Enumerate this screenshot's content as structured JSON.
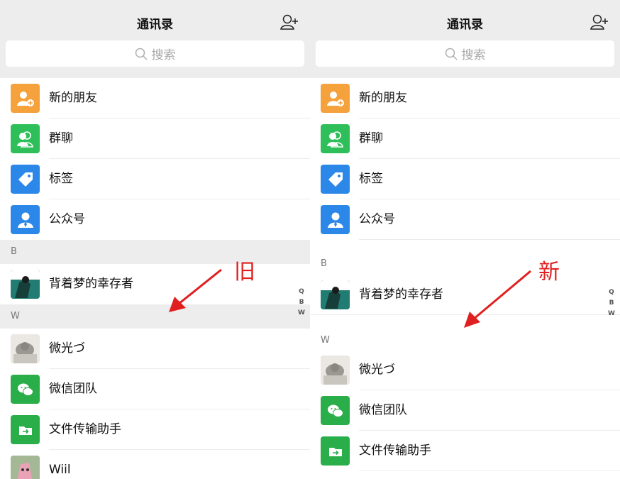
{
  "left": {
    "title": "通讯录",
    "search_placeholder": "搜索",
    "fixed_items": [
      {
        "label": "新的朋友",
        "icon": "add-friend-icon",
        "color": "#f5a13c"
      },
      {
        "label": "群聊",
        "icon": "group-chat-icon",
        "color": "#2ebf5a"
      },
      {
        "label": "标签",
        "icon": "tag-icon",
        "color": "#2b88e8"
      },
      {
        "label": "公众号",
        "icon": "official-account-icon",
        "color": "#2b88e8"
      }
    ],
    "section_b": "B",
    "contact_b": "背着梦的幸存者",
    "section_w": "W",
    "contacts_w": [
      {
        "label": "微光づ"
      },
      {
        "label": "微信团队"
      },
      {
        "label": "文件传输助手"
      },
      {
        "label": "Wiil"
      }
    ],
    "index": [
      "Q",
      "B",
      "W"
    ],
    "annotation": "旧"
  },
  "right": {
    "title": "通讯录",
    "search_placeholder": "搜索",
    "fixed_items": [
      {
        "label": "新的朋友",
        "icon": "add-friend-icon",
        "color": "#f5a13c"
      },
      {
        "label": "群聊",
        "icon": "group-chat-icon",
        "color": "#2ebf5a"
      },
      {
        "label": "标签",
        "icon": "tag-icon",
        "color": "#2b88e8"
      },
      {
        "label": "公众号",
        "icon": "official-account-icon",
        "color": "#2b88e8"
      }
    ],
    "section_b": "B",
    "contact_b": "背着梦的幸存者",
    "section_w": "W",
    "contacts_w": [
      {
        "label": "微光づ"
      },
      {
        "label": "微信团队"
      },
      {
        "label": "文件传输助手"
      }
    ],
    "index": [
      "Q",
      "B",
      "W"
    ],
    "annotation": "新"
  },
  "colors": {
    "header_bg": "#ededed",
    "annotation": "#e02020",
    "wechat_green": "#2aae4a"
  }
}
